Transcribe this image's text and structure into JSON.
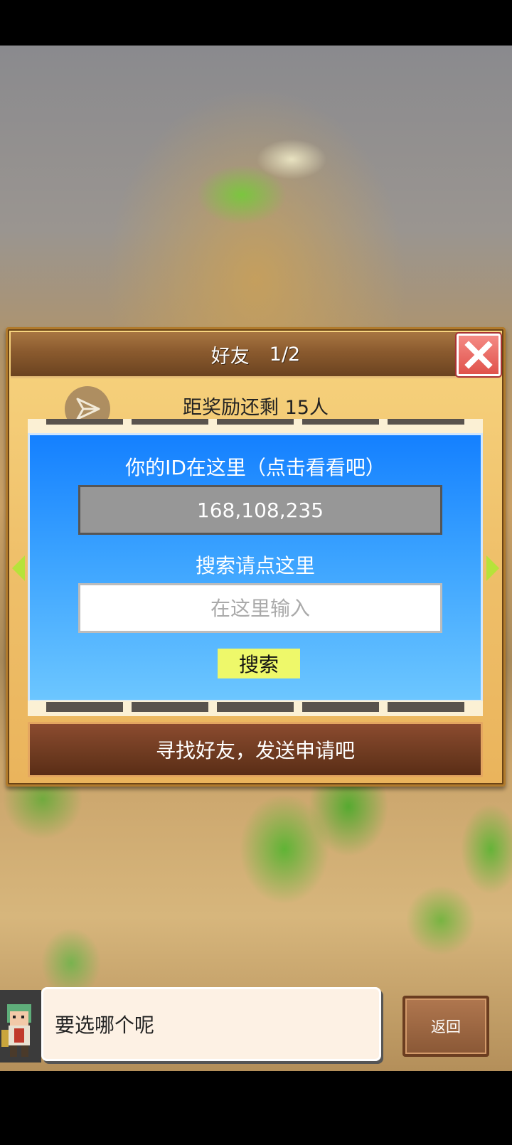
{
  "dialog": {
    "title": "好友",
    "page": "1/2",
    "reward_text": "距奖励还剩 15人",
    "id_label": "你的ID在这里（点击看看吧）",
    "id_value": "168,108,235",
    "search_label": "搜索请点这里",
    "search_placeholder": "在这里输入",
    "search_button": "搜索",
    "find_button": "寻找好友，发送申请吧"
  },
  "bottom": {
    "speech_text": "要选哪个呢",
    "back_button": "返回"
  },
  "icons": {
    "close": "close-icon",
    "send": "send-icon",
    "prev": "arrow-left-icon",
    "next": "arrow-right-icon"
  }
}
